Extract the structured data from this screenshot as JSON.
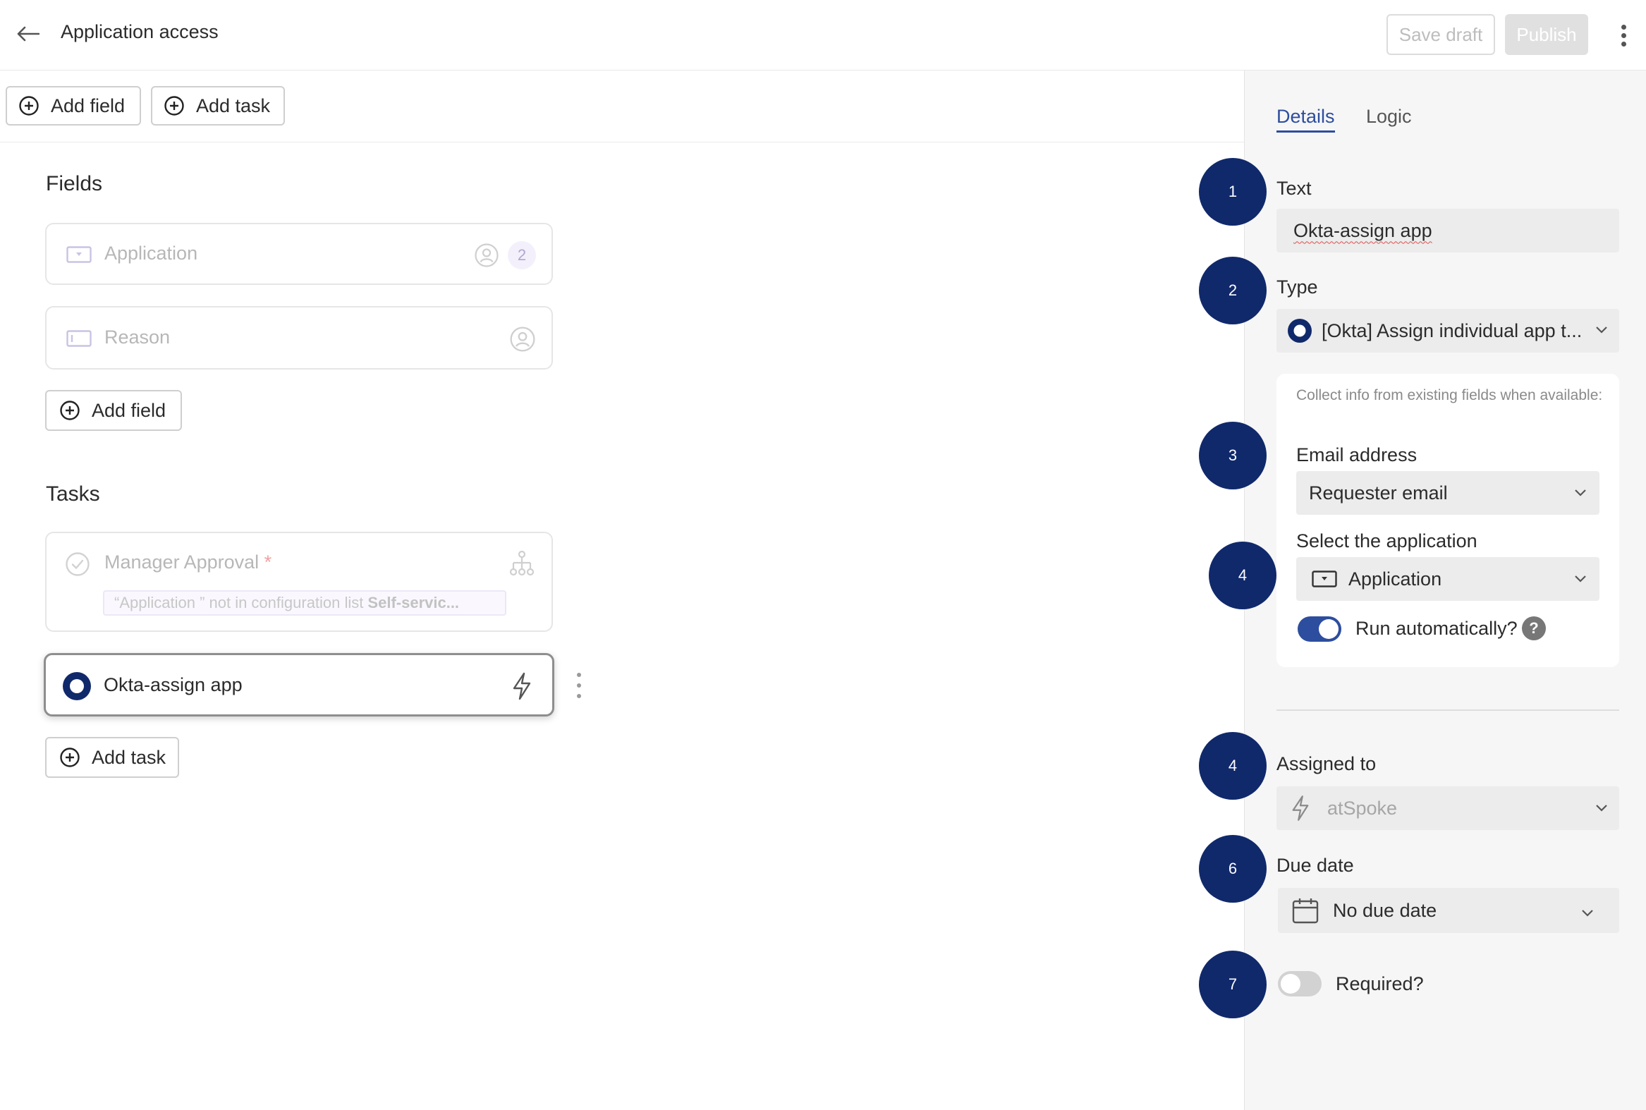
{
  "header": {
    "title": "Application access",
    "save_draft_label": "Save draft",
    "publish_label": "Publish"
  },
  "toolbar": {
    "add_field_label": "Add field",
    "add_task_label": "Add task"
  },
  "fields": {
    "section_title": "Fields",
    "items": [
      {
        "label": "Application",
        "count": "2"
      },
      {
        "label": "Reason"
      }
    ],
    "add_label": "Add field"
  },
  "tasks": {
    "section_title": "Tasks",
    "items": [
      {
        "label": "Manager Approval",
        "required_mark": "*",
        "condition_prefix": "“Application   ” not in configuration list",
        "condition_value": "Self-servic..."
      },
      {
        "label": "Okta-assign app"
      }
    ],
    "add_label": "Add task"
  },
  "panel": {
    "tabs": [
      {
        "label": "Details",
        "active": true
      },
      {
        "label": "Logic",
        "active": false
      }
    ],
    "text_label": "Text",
    "text_value": "Okta-assign app",
    "type_label": "Type",
    "type_value": "[Okta] Assign individual app t...",
    "collect_info_note": "Collect info from existing fields when available:",
    "email_label": "Email address",
    "email_value": "Requester email",
    "select_app_label": "Select the application",
    "select_app_value": "Application",
    "run_auto_label": "Run automatically?",
    "run_auto_on": true,
    "help_glyph": "?",
    "assigned_label": "Assigned to",
    "assigned_value": "atSpoke",
    "due_label": "Due date",
    "due_value": "No due date",
    "required_label": "Required?",
    "required_on": false
  },
  "badges": [
    "1",
    "2",
    "3",
    "4",
    "4",
    "6",
    "7"
  ],
  "colors": {
    "badge": "#10296b",
    "accent": "#2d4e9e",
    "panel_bg": "#f6f6f6"
  },
  "icons": [
    "back-arrow-icon",
    "kebab-icon",
    "plus-circle-icon",
    "dropdown-field-icon",
    "text-field-icon",
    "user-circle-icon",
    "check-circle-icon",
    "hierarchy-icon",
    "radio-icon",
    "lightning-icon",
    "chevron-down-icon",
    "help-icon",
    "calendar-icon"
  ]
}
